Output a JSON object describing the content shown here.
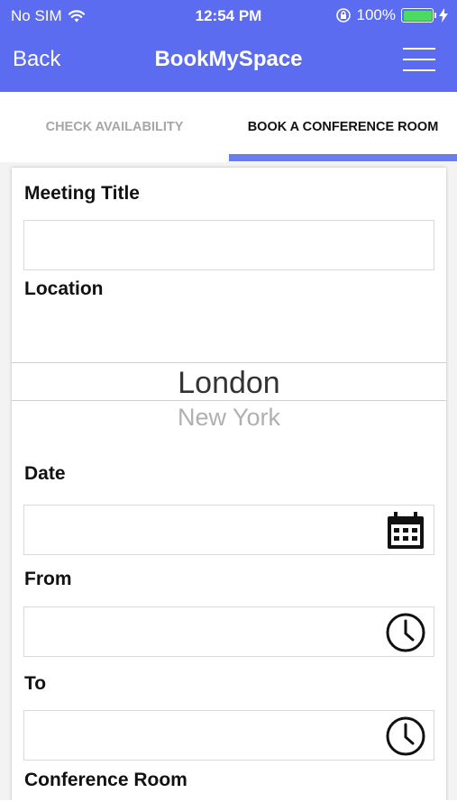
{
  "status_bar": {
    "carrier": "No SIM",
    "time": "12:54 PM",
    "battery": "100%",
    "battery_level": 1.0
  },
  "nav": {
    "back_label": "Back",
    "title": "BookMySpace"
  },
  "tabs": [
    {
      "label": "CHECK AVAILABILITY",
      "selected": false
    },
    {
      "label": "BOOK A CONFERENCE ROOM",
      "selected": true
    }
  ],
  "form": {
    "meeting_title": {
      "label": "Meeting Title",
      "value": ""
    },
    "location": {
      "label": "Location",
      "options": [
        "London",
        "New York"
      ],
      "selected": "London"
    },
    "date": {
      "label": "Date",
      "value": ""
    },
    "from": {
      "label": "From",
      "value": ""
    },
    "to": {
      "label": "To",
      "value": ""
    },
    "conference_room": {
      "label": "Conference Room"
    }
  },
  "colors": {
    "primary": "#5b6cf0",
    "tab_indicator": "#6b7bf0",
    "battery": "#4cd964"
  },
  "icons": {
    "wifi": "wifi-icon",
    "orientation_lock": "orientation-lock-icon",
    "battery": "battery-icon",
    "charging": "charging-bolt-icon",
    "menu": "hamburger-menu-icon",
    "calendar": "calendar-icon",
    "clock": "clock-icon"
  }
}
